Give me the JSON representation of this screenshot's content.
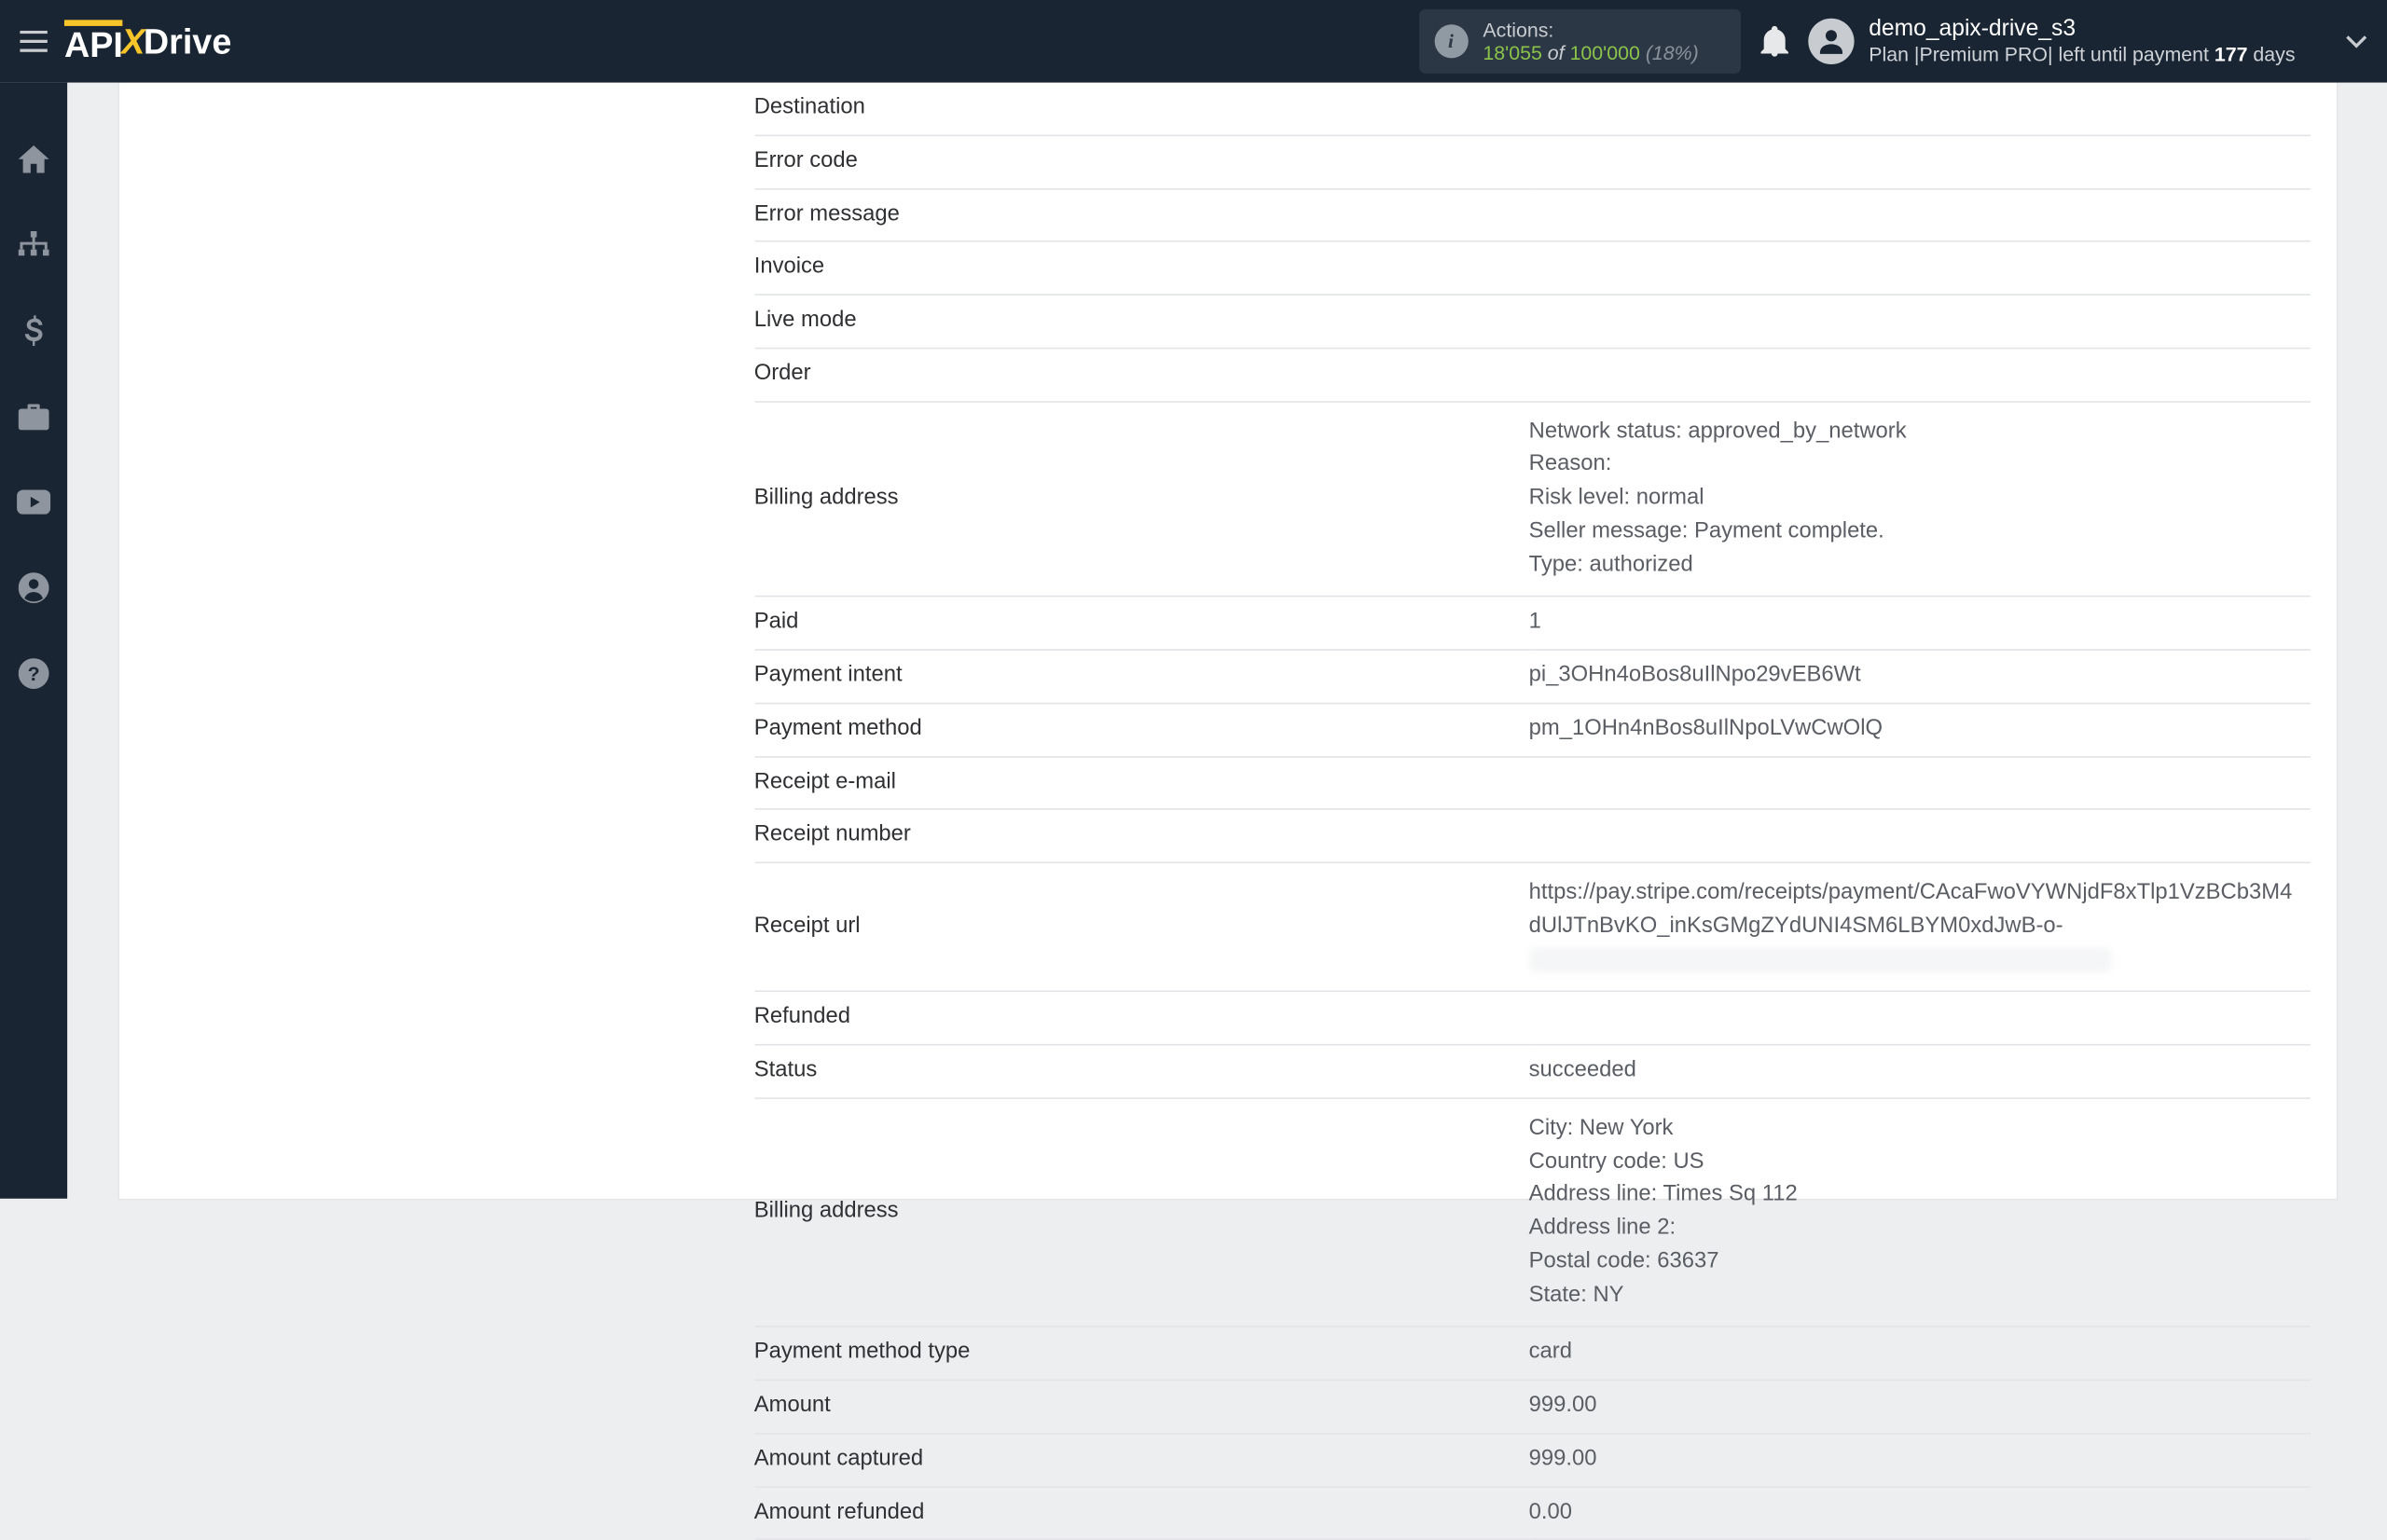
{
  "topbar": {
    "actions_label": "Actions:",
    "actions_used": "18'055",
    "actions_of": " of ",
    "actions_total": "100'000",
    "actions_pct": " (18%)",
    "username": "demo_apix-drive_s3",
    "plan_prefix": "Plan |",
    "plan_name": "Premium PRO",
    "plan_sep": "| left until payment ",
    "plan_days": "177",
    "plan_days_suffix": " days"
  },
  "rows": [
    {
      "k": "Destination",
      "v": ""
    },
    {
      "k": "Error code",
      "v": ""
    },
    {
      "k": "Error message",
      "v": ""
    },
    {
      "k": "Invoice",
      "v": ""
    },
    {
      "k": "Live mode",
      "v": ""
    },
    {
      "k": "Order",
      "v": ""
    },
    {
      "k": "Billing address",
      "v": "Network status: approved_by_network\nReason:\nRisk level: normal\nSeller message: Payment complete.\nType: authorized"
    },
    {
      "k": "Paid",
      "v": "1"
    },
    {
      "k": "Payment intent",
      "v": "pi_3OHn4oBos8uIlNpo29vEB6Wt"
    },
    {
      "k": "Payment method",
      "v": "pm_1OHn4nBos8uIlNpoLVwCwOlQ"
    },
    {
      "k": "Receipt e-mail",
      "v": ""
    },
    {
      "k": "Receipt number",
      "v": ""
    },
    {
      "k": "Receipt url",
      "v": "https://pay.stripe.com/receipts/payment/CAcaFwoVYWNjdF8xTlp1VzBCb3M4dUlJTnBvKO_inKsGMgZYdUNI4SM6LBYM0xdJwB-o-",
      "blur": true
    },
    {
      "k": "Refunded",
      "v": ""
    },
    {
      "k": "Status",
      "v": "succeeded"
    },
    {
      "k": "Billing address",
      "v": "City: New York\nCountry code: US\nAddress line: Times Sq 112\nAddress line 2:\nPostal code: 63637\nState: NY"
    },
    {
      "k": "Payment method type",
      "v": "card"
    },
    {
      "k": "Amount",
      "v": "999.00"
    },
    {
      "k": "Amount captured",
      "v": "999.00"
    },
    {
      "k": "Amount refunded",
      "v": "0.00"
    }
  ]
}
